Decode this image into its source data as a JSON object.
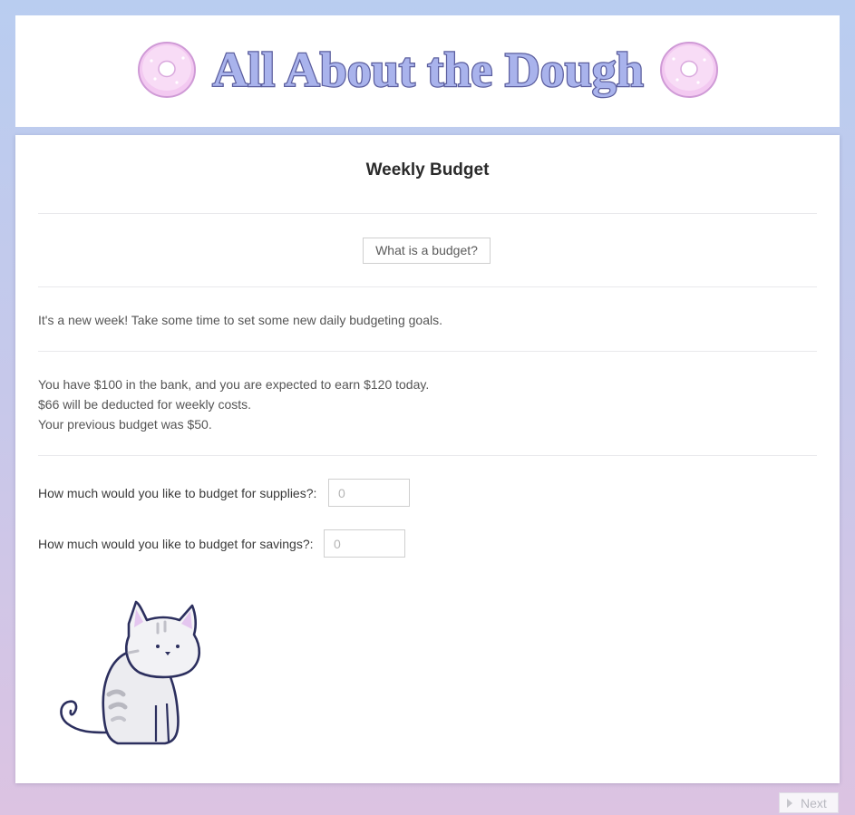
{
  "header": {
    "title": "All About the Dough"
  },
  "main": {
    "title": "Weekly Budget",
    "help_button_label": "What is a budget?",
    "intro": "It's a new week! Take some time to set some new daily budgeting goals.",
    "status_lines": [
      "You have $100 in the bank, and you are expected to earn $120 today.",
      "$66 will be deducted for weekly costs.",
      "Your previous budget was $50."
    ],
    "questions": [
      {
        "label": "How much would you like to budget for supplies?:",
        "placeholder": "0"
      },
      {
        "label": "How much would you like to budget for savings?:",
        "placeholder": "0"
      }
    ]
  },
  "footer": {
    "next_label": "Next"
  },
  "colors": {
    "title_fill": "#a9b3ec",
    "title_stroke": "#5b5e9e",
    "donut": "#f1c4ef",
    "background_top": "#b9cdf0",
    "background_bottom": "#dcc3e2"
  }
}
